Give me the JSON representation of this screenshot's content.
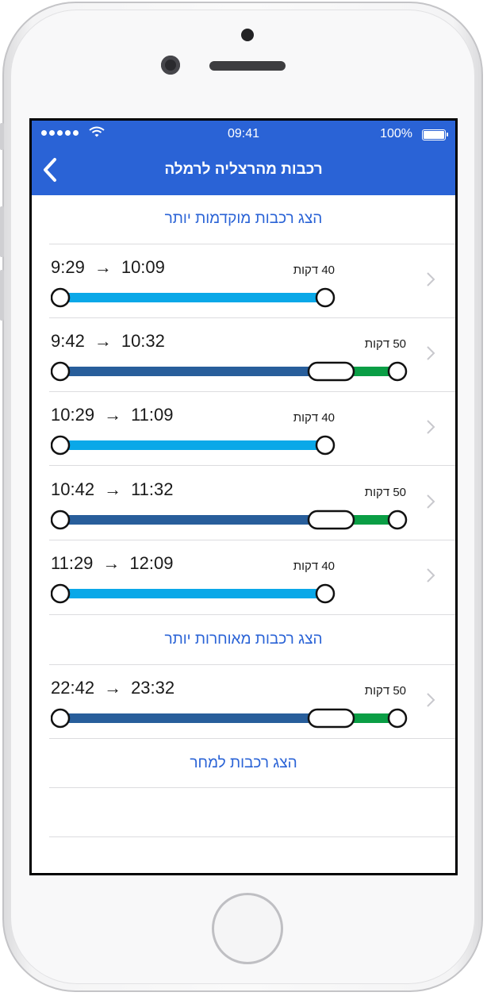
{
  "status_bar": {
    "time": "09:41",
    "battery": "100%"
  },
  "nav": {
    "title": "רכבות מהרצליה לרמלה"
  },
  "links": {
    "earlier": "הצג רכבות מוקדמות יותר",
    "later": "הצג רכבות מאוחרות יותר",
    "tomorrow": "הצג רכבות למחר"
  },
  "trips": [
    {
      "depart": "9:29",
      "arrow": "→",
      "arrive": "10:09",
      "duration": "40 דקות",
      "transfer": false
    },
    {
      "depart": "9:42",
      "arrow": "→",
      "arrive": "10:32",
      "duration": "50 דקות",
      "transfer": true
    },
    {
      "depart": "10:29",
      "arrow": "→",
      "arrive": "11:09",
      "duration": "40 דקות",
      "transfer": false
    },
    {
      "depart": "10:42",
      "arrow": "→",
      "arrive": "11:32",
      "duration": "50 דקות",
      "transfer": true
    },
    {
      "depart": "11:29",
      "arrow": "→",
      "arrive": "12:09",
      "duration": "40 דקות",
      "transfer": false
    },
    {
      "depart": "22:42",
      "arrow": "→",
      "arrive": "23:32",
      "duration": "50 דקות",
      "transfer": true
    }
  ],
  "colors": {
    "nav_bg": "#2a63d6",
    "direct_line": "#0aa8e8",
    "transfer_line_1": "#285e9b",
    "transfer_line_2": "#0a9e45",
    "link": "#2a63d6"
  },
  "icons": {
    "back": "chevron-left-icon",
    "row_chevron": "chevron-right-icon",
    "wifi": "wifi-icon",
    "battery": "battery-icon",
    "signal": "signal-icon"
  }
}
